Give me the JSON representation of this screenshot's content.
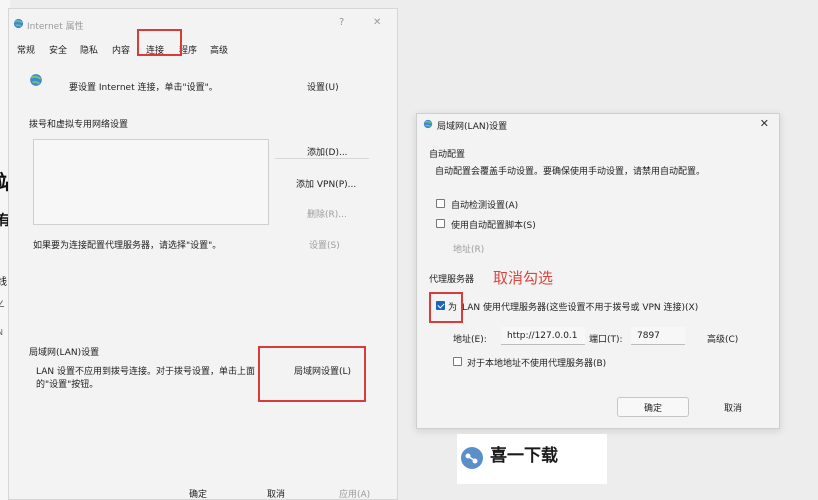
{
  "colors": {
    "highlight": "#d93a3a",
    "annotation": "#d8473e",
    "checkbox": "#1d63b7"
  },
  "left_edge": {
    "chars": [
      "站",
      "有",
      "线",
      "∠",
      "N"
    ]
  },
  "inet": {
    "title": "Internet 属性",
    "tabs": [
      "常规",
      "安全",
      "隐私",
      "内容",
      "连接",
      "程序",
      "高级"
    ],
    "setup_text": "要设置 Internet 连接，单击\"设置\"。",
    "setup_button": "设置(U)",
    "dialup_heading": "拨号和虚拟专用网络设置",
    "add_button": "添加(D)...",
    "add_vpn_button": "添加 VPN(P)...",
    "delete_button": "删除(R)...",
    "proxy_hint": "如果要为连接配置代理服务器，请选择\"设置\"。",
    "settings_button": "设置(S)",
    "lan_heading": "局域网(LAN)设置",
    "lan_desc_line1": "LAN 设置不应用到拨号连接。对于拨号设置，单击上面",
    "lan_desc_line2": "的\"设置\"按钮。",
    "lan_button": "局域网设置(L)",
    "ok": "确定",
    "cancel": "取消",
    "apply": "应用(A)"
  },
  "lan": {
    "title": "局域网(LAN)设置",
    "auto_config_heading": "自动配置",
    "auto_config_desc": "自动配置会覆盖手动设置。要确保使用手动设置，请禁用自动配置。",
    "auto_detect": "自动检测设置(A)",
    "auto_script": "使用自动配置脚本(S)",
    "address_disabled": "地址(R)",
    "proxy_heading": "代理服务器",
    "annotation": "取消勾选",
    "use_proxy_prefix": "为",
    "use_proxy": "LAN 使用代理服务器(这些设置不用于拨号或 VPN 连接)(X)",
    "address_label": "地址(E):",
    "address_value": "http://127.0.0.1",
    "port_label": "端口(T):",
    "port_value": "7897",
    "advanced": "高级(C)",
    "bypass_local": "对于本地地址不使用代理服务器(B)",
    "ok": "确定",
    "cancel": "取消"
  },
  "watermark": {
    "text": "喜一下载"
  }
}
